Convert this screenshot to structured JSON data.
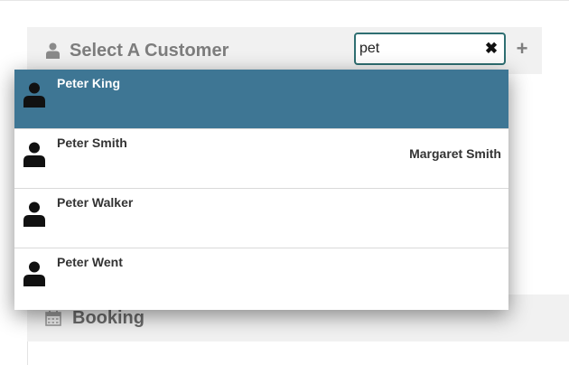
{
  "customer_panel": {
    "title": "Select A Customer",
    "search_value": "pet",
    "clear_symbol": "✖",
    "add_symbol": "+"
  },
  "booking_panel": {
    "title": "Booking"
  },
  "dropdown": {
    "items": [
      {
        "name": "Peter King",
        "secondary": "",
        "selected": true
      },
      {
        "name": "Peter Smith",
        "secondary": "Margaret Smith",
        "selected": false
      },
      {
        "name": "Peter Walker",
        "secondary": "",
        "selected": false
      },
      {
        "name": "Peter Went",
        "secondary": "",
        "selected": false
      }
    ]
  },
  "icons": {
    "panel_header": "user-icon",
    "booking_header": "calendar-icon",
    "dropdown_item": "person-icon",
    "clear": "close-icon",
    "add": "plus-icon"
  },
  "colors": {
    "selected_row": "#3e7694",
    "input_border": "#2f6f72",
    "panel_bg": "#f1f1f1",
    "panel_title": "#7d7d7d"
  }
}
